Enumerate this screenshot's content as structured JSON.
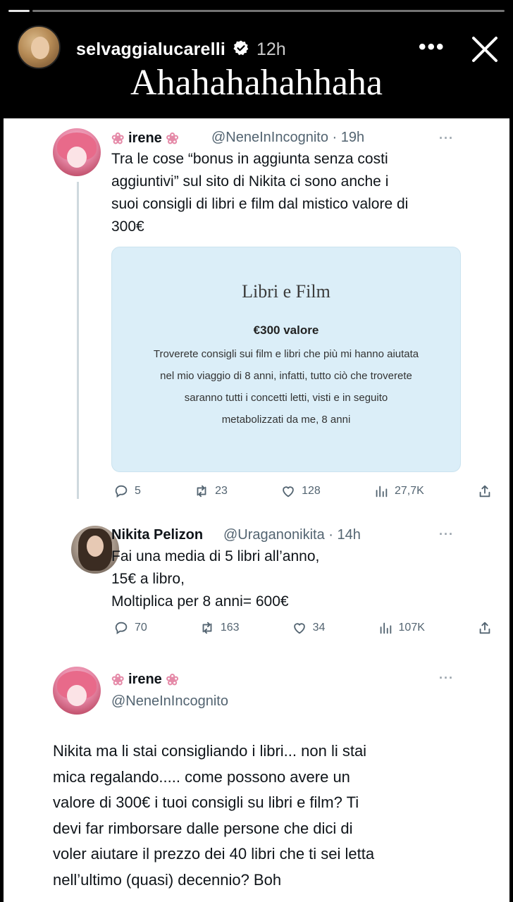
{
  "story": {
    "username": "selvaggialucarelli",
    "time": "12h",
    "caption": "Ahahahahahhaha",
    "more_icon": "more-horizontal-icon",
    "close_icon": "close-icon"
  },
  "tweets": [
    {
      "name": "irene",
      "handle": "@NeneInIncognito",
      "time": "· 19h",
      "text_lines": [
        "Tra le cose “bonus in aggiunta senza costi",
        "aggiuntivi” sul sito di Nikita ci sono anche i",
        "suoi consigli di libri e film dal mistico valore di",
        "300€"
      ],
      "embed": {
        "title": "Libri e Film",
        "price": "€300 valore",
        "desc_lines": [
          "Troverete consigli sui film e libri che più mi hanno aiutata",
          "nel mio viaggio di 8 anni, infatti, tutto ciò che troverete",
          "saranno tutti i concetti letti, visti e in seguito",
          "metabolizzati da me, 8 anni"
        ]
      },
      "stats": {
        "replies": "5",
        "retweets": "23",
        "likes": "128",
        "views": "27,7K"
      }
    },
    {
      "name": "Nikita Pelizon",
      "handle": "@Uraganonikita",
      "time": "· 14h",
      "text_lines": [
        "Fai una media di 5 libri all’anno,",
        "15€ a libro,",
        "Moltiplica per 8 anni= 600€"
      ],
      "stats": {
        "replies": "70",
        "retweets": "163",
        "likes": "34",
        "views": "107K"
      }
    },
    {
      "name": "irene",
      "handle": "@NeneInIncognito",
      "text_lines": [
        "Nikita ma li stai consigliando i libri... non li stai",
        "mica regalando..... come possono avere un",
        "valore di 300€ i tuoi consigli su libri e film? Ti",
        "devi far rimborsare dalle persone che dici di",
        "voler aiutare il prezzo dei 40 libri che ti sei letta",
        "nell’ultimo (quasi) decennio? Boh"
      ]
    }
  ]
}
